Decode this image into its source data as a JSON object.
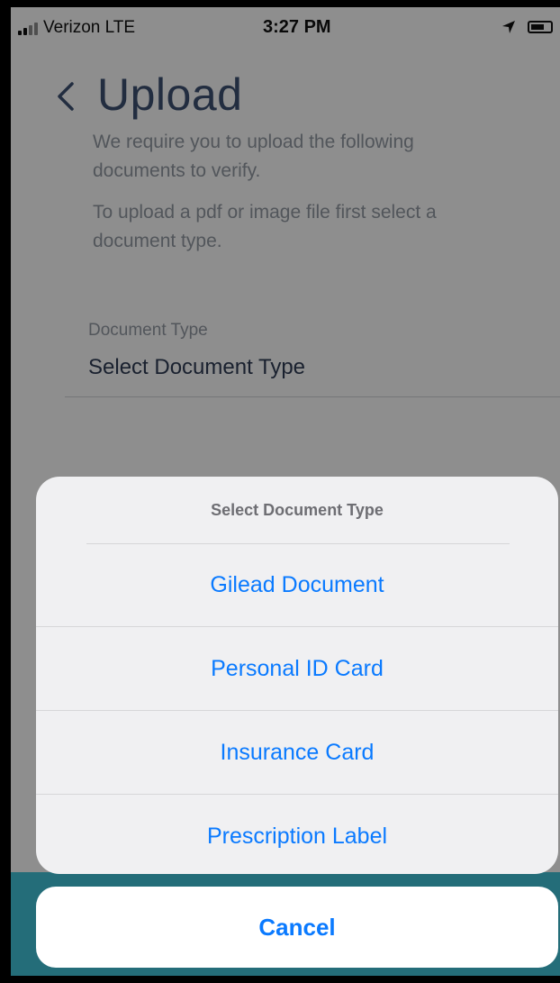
{
  "status_bar": {
    "carrier": "Verizon  LTE",
    "time": "3:27 PM"
  },
  "page": {
    "title": "Upload",
    "intro_1": "We require you to upload the following documents to verify.",
    "intro_2": "To upload a pdf or image file first select a document type.",
    "field_label": "Document Type",
    "field_value": "Select Document Type"
  },
  "action_sheet": {
    "title": "Select Document Type",
    "options": [
      "Gilead Document",
      "Personal ID Card",
      "Insurance Card",
      "Prescription Label"
    ],
    "cancel_label": "Cancel"
  },
  "colors": {
    "accent": "#0a7aff",
    "title": "#3c4f6e",
    "bottom_bar": "#3fbcd0"
  }
}
